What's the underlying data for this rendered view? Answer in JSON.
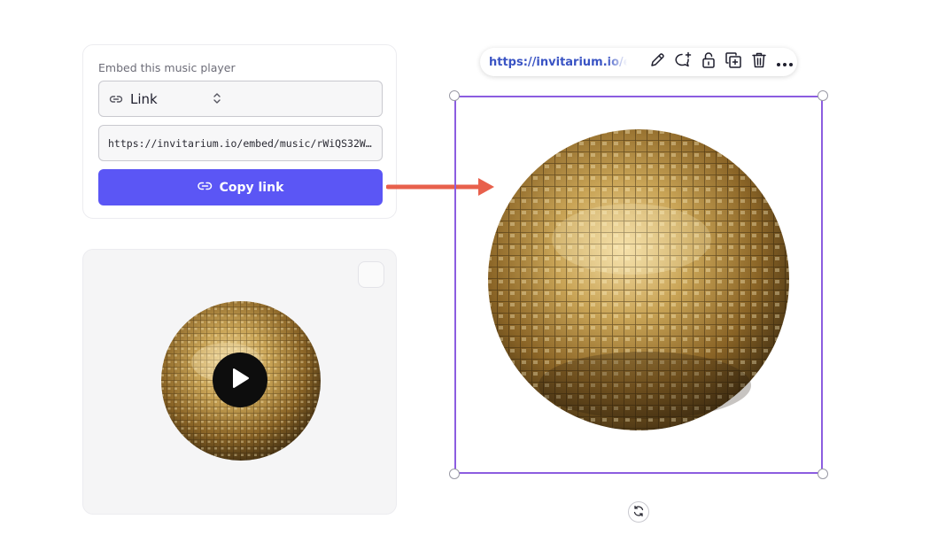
{
  "embed": {
    "title": "Embed this music player",
    "type_select": {
      "icon": "link-icon",
      "selected": "Link"
    },
    "url_value": "https://invitarium.io/embed/music/rWiQS32W…",
    "copy_button": {
      "icon": "link-icon",
      "label": "Copy link"
    }
  },
  "preview": {
    "image": "disco-ball",
    "play_icon": "play-icon",
    "checkbox_checked": false
  },
  "toolbar": {
    "url": "https://invitarium.io/embed/music",
    "icons": [
      "pencil-icon",
      "comment-add-icon",
      "unlock-icon",
      "duplicate-icon",
      "trash-icon",
      "more-icon"
    ]
  },
  "canvas": {
    "selected_element": "disco-ball-image",
    "rotate_icon": "rotate-icon"
  },
  "colors": {
    "accent": "#5b56f5",
    "selection": "#8c5de0",
    "arrow": "#e8604c",
    "toolbar_url": "#3a54c4",
    "gold": "#b08a3e"
  }
}
